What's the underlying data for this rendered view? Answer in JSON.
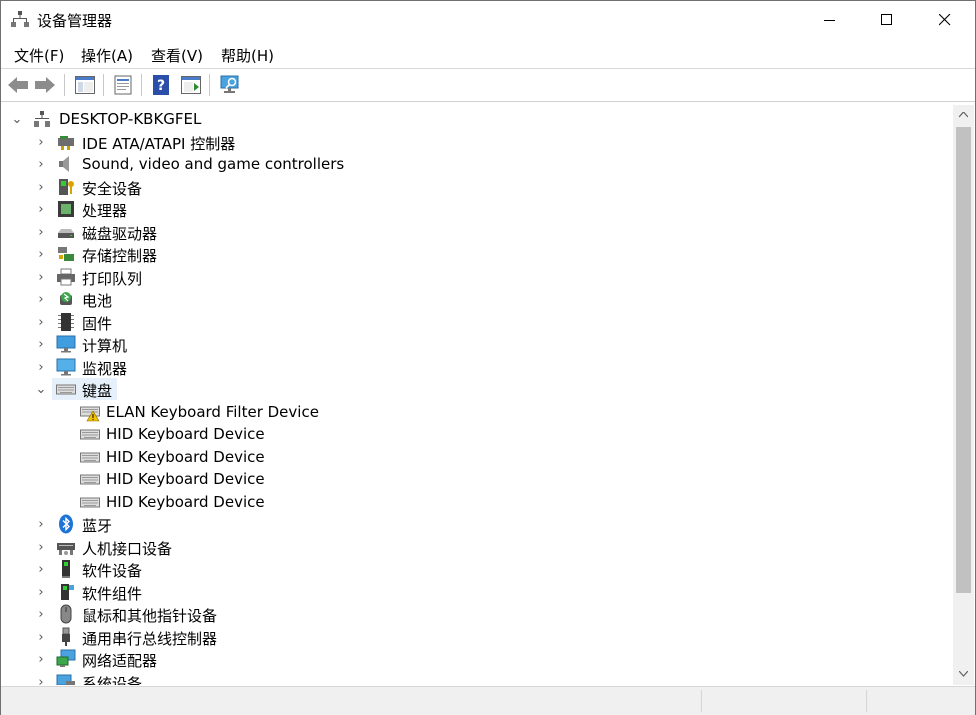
{
  "window": {
    "title": "设备管理器",
    "controls": {
      "minimize": "—",
      "maximize": "☐",
      "close": "✕"
    }
  },
  "menu": [
    "文件(F)",
    "操作(A)",
    "查看(V)",
    "帮助(H)"
  ],
  "toolbar": {
    "buttons": [
      "back-icon",
      "forward-icon",
      "show-hide-console-tree-icon",
      "properties-icon",
      "help-icon",
      "show-action-pane-icon",
      "scan-hardware-icon"
    ]
  },
  "tree": {
    "root": "DESKTOP-KBKGFEL",
    "categories": [
      {
        "label": "IDE ATA/ATAPI 控制器",
        "icon": "ide-controller-icon"
      },
      {
        "label": "Sound, video and game controllers",
        "icon": "speaker-icon"
      },
      {
        "label": "安全设备",
        "icon": "security-device-icon"
      },
      {
        "label": "处理器",
        "icon": "processor-icon"
      },
      {
        "label": "磁盘驱动器",
        "icon": "disk-drive-icon"
      },
      {
        "label": "存储控制器",
        "icon": "storage-controller-icon"
      },
      {
        "label": "打印队列",
        "icon": "printer-icon"
      },
      {
        "label": "电池",
        "icon": "battery-icon"
      },
      {
        "label": "固件",
        "icon": "firmware-icon"
      },
      {
        "label": "计算机",
        "icon": "computer-icon"
      },
      {
        "label": "监视器",
        "icon": "monitor-icon"
      },
      {
        "label": "键盘",
        "icon": "keyboard-icon",
        "expanded": true,
        "children": [
          {
            "label": "ELAN Keyboard Filter Device",
            "warning": true
          },
          {
            "label": "HID Keyboard Device"
          },
          {
            "label": "HID Keyboard Device"
          },
          {
            "label": "HID Keyboard Device"
          },
          {
            "label": "HID Keyboard Device"
          }
        ]
      },
      {
        "label": "蓝牙",
        "icon": "bluetooth-icon"
      },
      {
        "label": "人机接口设备",
        "icon": "hid-icon"
      },
      {
        "label": "软件设备",
        "icon": "software-device-icon"
      },
      {
        "label": "软件组件",
        "icon": "software-component-icon"
      },
      {
        "label": "鼠标和其他指针设备",
        "icon": "mouse-icon"
      },
      {
        "label": "通用串行总线控制器",
        "icon": "usb-icon"
      },
      {
        "label": "网络适配器",
        "icon": "network-adapter-icon"
      },
      {
        "label": "系统设备",
        "icon": "system-device-icon"
      }
    ]
  },
  "colors": {
    "selection": "#e5f0fb",
    "bluetooth": "#1e73d6",
    "warning": "#f2c200"
  }
}
